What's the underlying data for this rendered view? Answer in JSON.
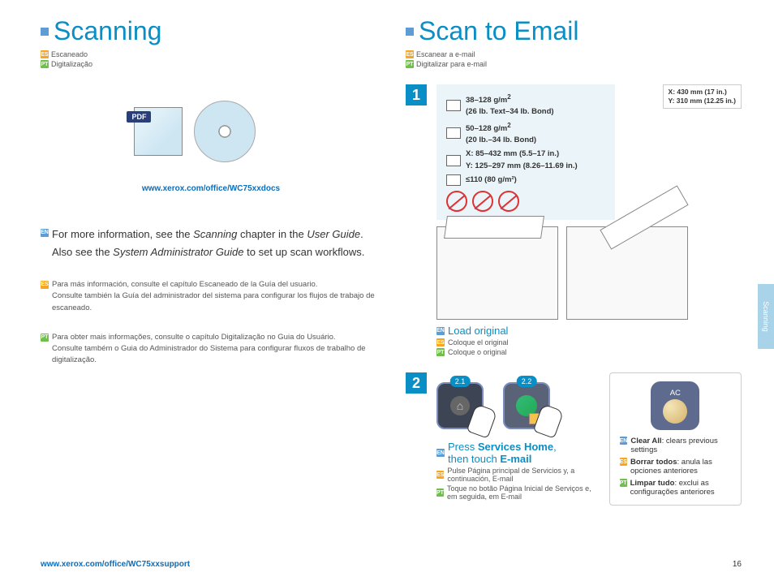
{
  "left": {
    "title": "Scanning",
    "es": "Escaneado",
    "pt": "Digitalização",
    "docs_link": "www.xerox.com/office/WC75xxdocs",
    "en_p1": "For more information, see the ",
    "en_i1": "Scanning",
    "en_p2": " chapter in the ",
    "en_i2": "User Guide",
    "en_p3": ".",
    "en_p4": "Also see the ",
    "en_i3": "System Administrator Guide",
    "en_p5": " to set up scan workflows.",
    "es_p": "Para más información, consulte el capítulo Escaneado de la Guía del usuario.\nConsulte también la Guía del administrador del sistema para configurar los flujos de trabajo de escaneado.",
    "pt_p": "Para obter mais informações, consulte o capítulo Digitalização no Guia do Usuário.\nConsulte também o Guia do Administrador do Sistema para configurar fluxos de trabalho de digitalização."
  },
  "right": {
    "title": "Scan to Email",
    "es": "Escanear a e-mail",
    "pt": "Digitalizar para e-mail",
    "spec1a": "38–128 g/m",
    "spec1b": "(26 lb. Text–34 lb. Bond)",
    "spec2a": "50–128 g/m",
    "spec2b": "(20 lb.–34 lb. Bond)",
    "specX": "X: 85–432 mm (5.5–17 in.)",
    "specY": "Y: 125–297 mm (8.26–11.69 in.)",
    "spec110": "≤110 (80 g/m²)",
    "rX": "X: 430 mm (17 in.)",
    "rY": "Y: 310 mm (12.25 in.)",
    "step1_en": "Load original",
    "step1_es": "Coloque el original",
    "step1_pt": "Coloque o original",
    "pill21": "2.1",
    "pill22": "2.2",
    "step2_en1": "Press ",
    "step2_en2": "Services Home",
    "step2_en3": ",",
    "step2_en4": "then touch ",
    "step2_en5": "E-mail",
    "step2_es": "Pulse Página principal de Servicios y, a continuación, E-mail",
    "step2_pt": "Toque no botão Página Inicial de Serviços e, em seguida, em E-mail",
    "ac": "AC",
    "clear_en1": "Clear All",
    "clear_en2": ": clears previous settings",
    "clear_es1": "Borrar todos",
    "clear_es2": ": anula las opciones anteriores",
    "clear_pt1": "Limpar tudo",
    "clear_pt2": ": exclui as configurações anteriores"
  },
  "footer": {
    "link": "www.xerox.com/office/WC75xxsupport",
    "page": "16"
  },
  "tab": "Scanning",
  "lang": {
    "en": "EN",
    "es": "ES",
    "pt": "PT"
  },
  "steps": {
    "s1": "1",
    "s2": "2"
  },
  "pdf": "PDF"
}
